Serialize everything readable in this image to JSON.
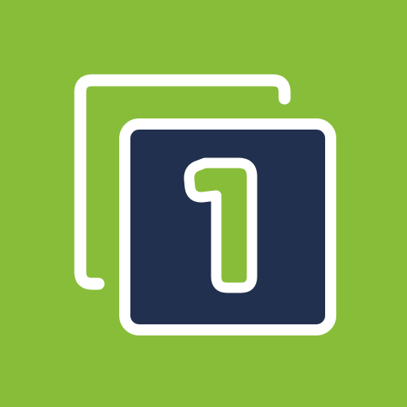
{
  "icon": {
    "name": "layer-one-icon",
    "digit": "1"
  },
  "colors": {
    "background": "#88bd3a",
    "front_square": "#22304f",
    "stroke": "#ffffff"
  }
}
